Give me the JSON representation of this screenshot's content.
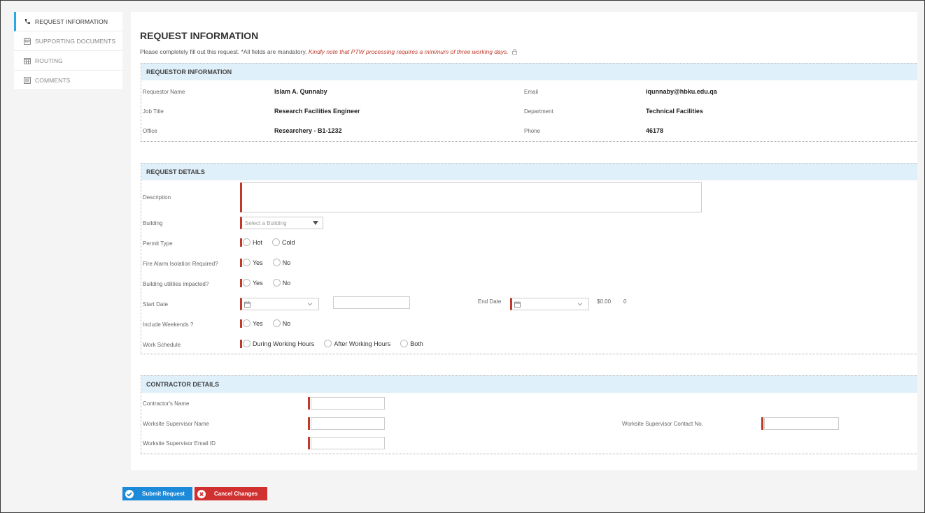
{
  "sidebar": {
    "items": [
      {
        "label": "REQUEST INFORMATION",
        "icon": "phone-icon",
        "active": true
      },
      {
        "label": "SUPPORTING DOCUMENTS",
        "icon": "calendar-icon"
      },
      {
        "label": "ROUTING",
        "icon": "calendar-grid-icon"
      },
      {
        "label": "COMMENTS",
        "icon": "list-icon"
      }
    ]
  },
  "page": {
    "title": "REQUEST INFORMATION",
    "intro": "Please completely fill out this request. *All fields are mandatory.",
    "note": "Kindly note that PTW processing requires a minimum of three working days."
  },
  "requestor": {
    "heading": "REQUESTOR INFORMATION",
    "name_label": "Requestor Name",
    "name": "Islam A. Qunnaby",
    "email_label": "Email",
    "email": "iqunnaby@hbku.edu.qa",
    "job_label": "Job Title",
    "job": "Research Facilities Engineer",
    "dept_label": "Department",
    "dept": "Technical Facilities",
    "office_label": "Office",
    "office": "Researchery - B1-1232",
    "phone_label": "Phone",
    "phone": "46178"
  },
  "details": {
    "heading": "REQUEST DETAILS",
    "description_label": "Description",
    "building_label": "Building",
    "building_placeholder": "Select a Building",
    "permit_label": "Permit Type",
    "permit_options": [
      "Hot",
      "Cold"
    ],
    "fire_label": "Fire Alarm Isolation Required?",
    "utilities_label": "Building utilities impacted?",
    "yes": "Yes",
    "no": "No",
    "start_label": "Start Date",
    "end_label": "End Date",
    "cost": "$0.00",
    "count": "0",
    "weekends_label": "Include Weekends ?",
    "schedule_label": "Work Schedule",
    "schedule_options": [
      "During Working Hours",
      "After Working Hours",
      "Both"
    ]
  },
  "contractor": {
    "heading": "CONTRACTOR DETAILS",
    "name_label": "Contractor's Name",
    "supervisor_label": "Worksite Supervisor Name",
    "contact_label": "Worksite Supervisor Contact No.",
    "email_label": "Worksite Supervisor Email ID"
  },
  "buttons": {
    "submit": "Submit Request",
    "cancel": "Cancel Changes"
  },
  "colors": {
    "accent": "#29a9e1",
    "header_bg": "#dff0fa",
    "required": "#c0392b",
    "submit": "#1d8ad9",
    "cancel": "#d03030"
  }
}
